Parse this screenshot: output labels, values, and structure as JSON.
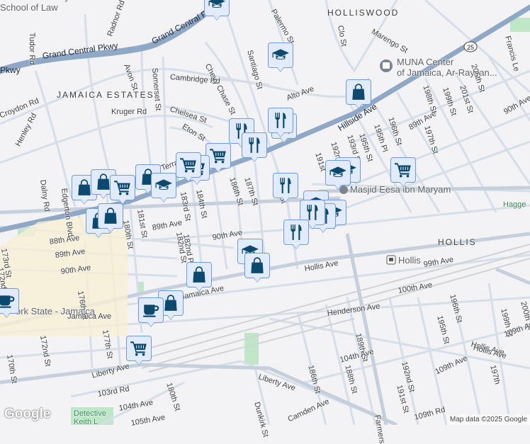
{
  "neighborhoods": {
    "jamaica_estates": "JAMAICA ESTATES",
    "holliswood": "HOLLISWOOD",
    "hollis": "HOLLIS"
  },
  "highways": {
    "gcp1": "Grand Central Pkwy",
    "gcp2": "Grand Central Pkwy",
    "gcp3": "Pkwy",
    "hillside": "Hillside Ave",
    "route": "25"
  },
  "pois": {
    "law": "John's University\nSchool of Law",
    "muna": "MUNA Center\nof Jamaica, Ar-Rayyan...",
    "masjid": "Masjid Eesa ibn Maryam",
    "hollis_station": "Hollis",
    "jamaica_station": "ork State - Jamaica",
    "hagge": "Hagge",
    "detective": "Detective\nKeith L"
  },
  "streets": [
    "Radnor Rd",
    "Tudor Rd",
    "Avon St",
    "Somerset St",
    "Cambridge Rd",
    "Chevy Chase St",
    "Santiago St",
    "Palermo St",
    "Clo St",
    "Marengo St",
    "Kruger Rd",
    "Chelsea St",
    "Eton St",
    "Croydon Rd",
    "Henley Rd",
    "Dalny Rd",
    "Edgerton Blvd",
    "Alto Ave",
    "89th Ave",
    "90th Ave",
    "Francis Le",
    "205th St",
    "198th St",
    "199th St",
    "201st St",
    "196th St",
    "197th St",
    "195th Pl",
    "195th St",
    "193rd St",
    "192nd St",
    "191st",
    "186th St",
    "187th St",
    "184th St",
    "183rd St",
    "182nd St",
    "182nd Pl",
    "181st St",
    "180th St",
    "89th Ave",
    "90th Ave",
    "88th Ave",
    "89th Ave",
    "90th Ave",
    "173rd St",
    "172nd St",
    "176th St",
    "177th St",
    "170th St",
    "172nd St",
    "Hollis Ave",
    "99th Ave",
    "100th Ave",
    "Henderson Ave",
    "Hollis Ave",
    "Jamaica Ave",
    "Jamaica Ave",
    "Liberty Ave",
    "Liberty Ave",
    "103rd Rd",
    "104th Ave",
    "105th Ave",
    "180th St",
    "Dunkirk St",
    "Camden Ave",
    "186th St",
    "188th St",
    "189th St",
    "104th Ave",
    "192nd St",
    "191st St",
    "195th St",
    "196th St",
    "109th Ave",
    "109th Rd",
    "Farmers",
    "197th",
    "199th St",
    "200th St",
    "109th Ave",
    "Hollis Ave",
    "Terrace",
    "188th St"
  ],
  "markers": [
    {
      "icon": "graduation-cap-icon"
    },
    {
      "icon": "graduation-cap-icon"
    },
    {
      "icon": "shopping-bag-icon"
    },
    {
      "icon": "shopping-cart-icon"
    },
    {
      "icon": "restaurant-icon"
    },
    {
      "icon": "shopping-cart-icon"
    },
    {
      "icon": "restaurant-icon"
    },
    {
      "icon": "restaurant-icon"
    },
    {
      "icon": "shopping-cart-icon"
    },
    {
      "icon": "shopping-cart-icon"
    },
    {
      "icon": "shopping-cart-icon"
    },
    {
      "icon": "shopping-bag-icon"
    },
    {
      "icon": "graduation-cap-icon"
    },
    {
      "icon": "shopping-bag-icon"
    },
    {
      "icon": "shopping-bag-icon"
    },
    {
      "icon": "shopping-cart-icon"
    },
    {
      "icon": "shopping-bag-icon"
    },
    {
      "icon": "shopping-bag-icon"
    },
    {
      "icon": "restaurant-icon"
    },
    {
      "icon": "graduation-cap-icon"
    },
    {
      "icon": "graduation-cap-icon"
    },
    {
      "icon": "graduation-cap-icon"
    },
    {
      "icon": "graduation-cap-icon"
    },
    {
      "icon": "restaurant-icon"
    },
    {
      "icon": "restaurant-icon"
    },
    {
      "icon": "restaurant-icon"
    },
    {
      "icon": "graduation-cap-icon"
    },
    {
      "icon": "shopping-bag-icon"
    },
    {
      "icon": "shopping-bag-icon"
    },
    {
      "icon": "shopping-bag-icon"
    },
    {
      "icon": "coffee-icon"
    },
    {
      "icon": "coffee-icon"
    },
    {
      "icon": "shopping-cart-icon"
    }
  ],
  "attribution": "Map data ©2025 Google",
  "logo": "Google",
  "colors": {
    "marker_fill": "#e2ebfc",
    "marker_border": "#6f9be6",
    "icon": "#0b4a6e",
    "highway": "#8ea8c6",
    "street": "#d6dee8"
  }
}
